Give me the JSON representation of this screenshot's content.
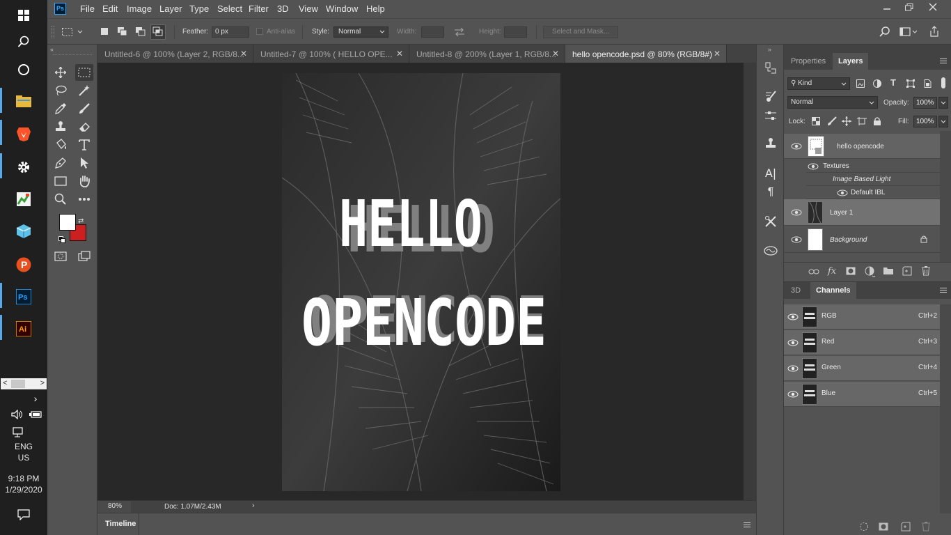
{
  "taskbar": {
    "clock_time": "9:18 PM",
    "clock_date": "1/29/2020",
    "lang_line1": "ENG",
    "lang_line2": "US",
    "apps": [
      "file-explorer",
      "brave",
      "settings",
      "sketch-app",
      "cube-app",
      "psiphon",
      "photoshop",
      "illustrator"
    ]
  },
  "app": {
    "logo": "Ps",
    "menu": [
      "File",
      "Edit",
      "Image",
      "Layer",
      "Type",
      "Select",
      "Filter",
      "3D",
      "View",
      "Window",
      "Help"
    ]
  },
  "options": {
    "feather_label": "Feather:",
    "feather_value": "0 px",
    "antialias_label": "Anti-alias",
    "style_label": "Style:",
    "style_value": "Normal",
    "width_label": "Width:",
    "height_label": "Height:",
    "select_mask": "Select and Mask..."
  },
  "tabs": [
    {
      "label": "Untitled-6 @ 100% (Layer 2, RGB/8..."
    },
    {
      "label": "Untitled-7 @ 100% (    HELLO OPE..."
    },
    {
      "label": "Untitled-8 @ 200% (Layer 1, RGB/8..."
    },
    {
      "label": "hello opencode.psd @ 80% (RGB/8#)",
      "active": true
    }
  ],
  "canvas": {
    "line1": "HELLO",
    "line2": "OPENCODE"
  },
  "status": {
    "zoom": "80%",
    "doc": "Doc: 1.07M/2.43M"
  },
  "timeline_label": "Timeline",
  "layers_panel": {
    "tab_properties": "Properties",
    "tab_layers": "Layers",
    "kind_label": "Kind",
    "blend_mode": "Normal",
    "opacity_label": "Opacity:",
    "opacity_value": "100%",
    "lock_label": "Lock:",
    "fill_label": "Fill:",
    "fill_value": "100%",
    "layers": [
      {
        "name": "hello opencode"
      },
      {
        "name": "Textures",
        "sub": true
      },
      {
        "name": "Image Based Light",
        "sub": true
      },
      {
        "name": "Default IBL",
        "sub": true
      },
      {
        "name": "Layer 1"
      },
      {
        "name": "Background"
      }
    ]
  },
  "channels_panel": {
    "tab_3d": "3D",
    "tab_channels": "Channels",
    "channels": [
      {
        "name": "RGB",
        "shortcut": "Ctrl+2"
      },
      {
        "name": "Red",
        "shortcut": "Ctrl+3"
      },
      {
        "name": "Green",
        "shortcut": "Ctrl+4"
      },
      {
        "name": "Blue",
        "shortcut": "Ctrl+5"
      }
    ]
  },
  "colors": {
    "foreground": "#ffffff",
    "background": "#cc1f1f"
  }
}
